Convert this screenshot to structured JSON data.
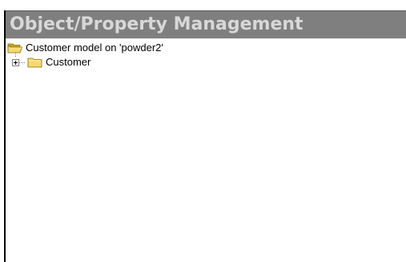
{
  "panel": {
    "title": "Object/Property Management"
  },
  "tree": {
    "root": {
      "label": "Customer model on 'powder2'",
      "icon": "open-folder-icon"
    },
    "children": [
      {
        "label": "Customer",
        "icon": "folder-icon",
        "expander": "plus"
      }
    ]
  },
  "colors": {
    "title_bar": "#7f7f7f",
    "title_text": "#d8d8d8",
    "folder": "#f5d96b"
  }
}
